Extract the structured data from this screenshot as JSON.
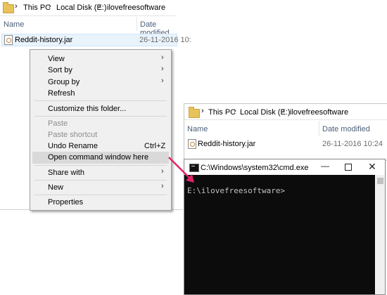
{
  "left_explorer": {
    "breadcrumb": [
      "This PC",
      "Local Disk (E:)",
      "ilovefreesoftware"
    ],
    "col_name": "Name",
    "col_date": "Date modified",
    "file_name": "Reddit-history.jar",
    "file_date": "26-11-2016 10:"
  },
  "context_menu": {
    "view": "View",
    "sort_by": "Sort by",
    "group_by": "Group by",
    "refresh": "Refresh",
    "customize": "Customize this folder...",
    "paste": "Paste",
    "paste_shortcut": "Paste shortcut",
    "undo_rename": "Undo Rename",
    "undo_shortcut": "Ctrl+Z",
    "open_cmd": "Open command window here",
    "share_with": "Share with",
    "new": "New",
    "properties": "Properties"
  },
  "right_explorer": {
    "breadcrumb": [
      "This PC",
      "Local Disk (E:)",
      "ilovefreesoftware"
    ],
    "col_name": "Name",
    "col_date": "Date modified",
    "file_name": "Reddit-history.jar",
    "file_date": "26-11-2016 10:24"
  },
  "cmd": {
    "title": "C:\\Windows\\system32\\cmd.exe",
    "prompt": "E:\\ilovefreesoftware>"
  },
  "colors": {
    "arrow": "#e0246a",
    "console_bg": "#0c0c0c",
    "console_fg": "#c0c0c0"
  },
  "icons": [
    "folder-icon",
    "jar-file-icon",
    "chevron-right-icon",
    "cmd-icon",
    "minimize-icon",
    "maximize-icon",
    "close-icon",
    "pointer-arrow"
  ]
}
